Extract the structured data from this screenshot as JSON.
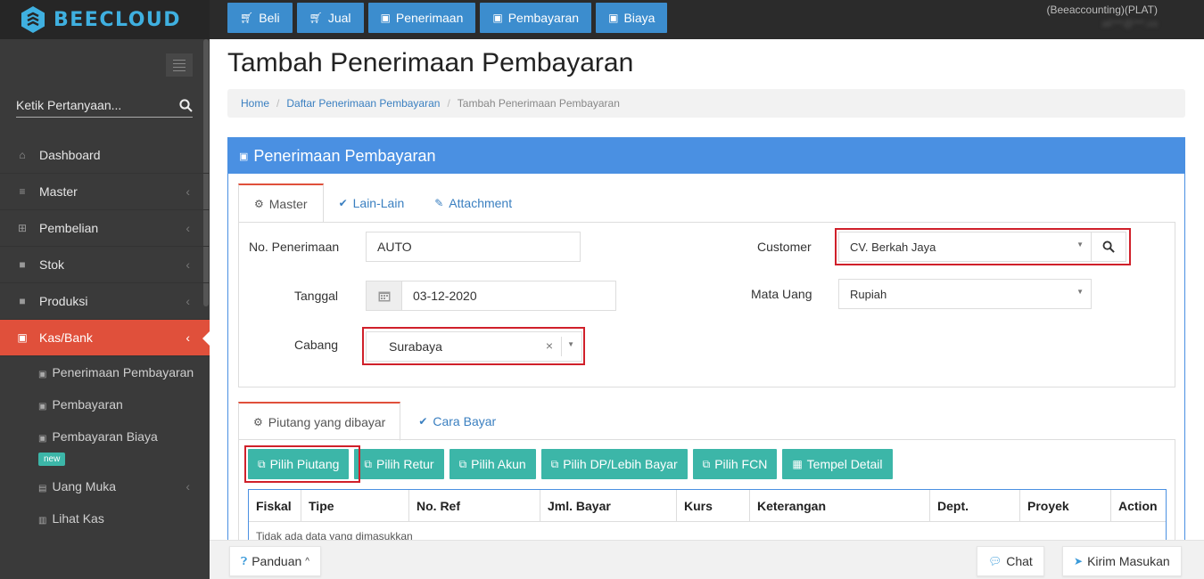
{
  "app": {
    "logo_text": "BEECLOUD",
    "brand_color": "#3fb0e0"
  },
  "topnav": [
    {
      "label": "Beli",
      "icon": "cart-icon"
    },
    {
      "label": "Jual",
      "icon": "cart-icon"
    },
    {
      "label": "Penerimaan",
      "icon": "money-icon"
    },
    {
      "label": "Pembayaran",
      "icon": "money-icon"
    },
    {
      "label": "Biaya",
      "icon": "money-icon"
    }
  ],
  "user": {
    "company": "(Beeaccounting)(PLAT)",
    "email": "ali***@***.co"
  },
  "sidebar": {
    "search_placeholder": "Ketik Pertanyaan...",
    "items": [
      {
        "label": "Dashboard",
        "icon": "dashboard-icon",
        "has_children": false
      },
      {
        "label": "Master",
        "icon": "database-icon",
        "has_children": true
      },
      {
        "label": "Pembelian",
        "icon": "cart-icon",
        "has_children": true
      },
      {
        "label": "Stok",
        "icon": "box-icon",
        "has_children": true
      },
      {
        "label": "Produksi",
        "icon": "box-icon",
        "has_children": true
      },
      {
        "label": "Kas/Bank",
        "icon": "money-icon",
        "has_children": true,
        "active": true
      }
    ],
    "subitems": [
      {
        "label": "Penerimaan Pembayaran"
      },
      {
        "label": "Pembayaran"
      },
      {
        "label": "Pembayaran Biaya",
        "badge": "new"
      },
      {
        "label": "Uang Muka",
        "has_children": true
      },
      {
        "label": "Lihat Kas"
      }
    ]
  },
  "page": {
    "title": "Tambah Penerimaan Pembayaran",
    "breadcrumb": [
      "Home",
      "Daftar Penerimaan Pembayaran",
      "Tambah Penerimaan Pembayaran"
    ]
  },
  "panel": {
    "title": "Penerimaan Pembayaran",
    "accent": "#4a90e2",
    "tabs": [
      "Master",
      "Lain-Lain",
      "Attachment"
    ],
    "form": {
      "no_penerimaan_label": "No. Penerimaan",
      "no_penerimaan_value": "AUTO",
      "tanggal_label": "Tanggal",
      "tanggal_value": "03-12-2020",
      "cabang_label": "Cabang",
      "cabang_value": "Surabaya",
      "customer_label": "Customer",
      "customer_value": "CV. Berkah Jaya",
      "mata_uang_label": "Mata Uang",
      "mata_uang_value": "Rupiah"
    },
    "detail_tabs": [
      "Piutang yang dibayar",
      "Cara Bayar"
    ],
    "actions": [
      "Pilih Piutang",
      "Pilih Retur",
      "Pilih Akun",
      "Pilih DP/Lebih Bayar",
      "Pilih FCN",
      "Tempel Detail"
    ],
    "table": {
      "columns": [
        "Fiskal",
        "Tipe",
        "No. Ref",
        "Jml. Bayar",
        "Kurs",
        "Keterangan",
        "Dept.",
        "Proyek",
        "Action"
      ],
      "empty_text": "Tidak ada data yang dimasukkan"
    }
  },
  "bottom": {
    "panduan": "Panduan",
    "chat": "Chat",
    "kirim": "Kirim Masukan"
  },
  "colors": {
    "active_menu": "#e0503b",
    "action_button": "#3cb6a8",
    "nav_button": "#3c8dce",
    "highlight": "#d0202a"
  }
}
